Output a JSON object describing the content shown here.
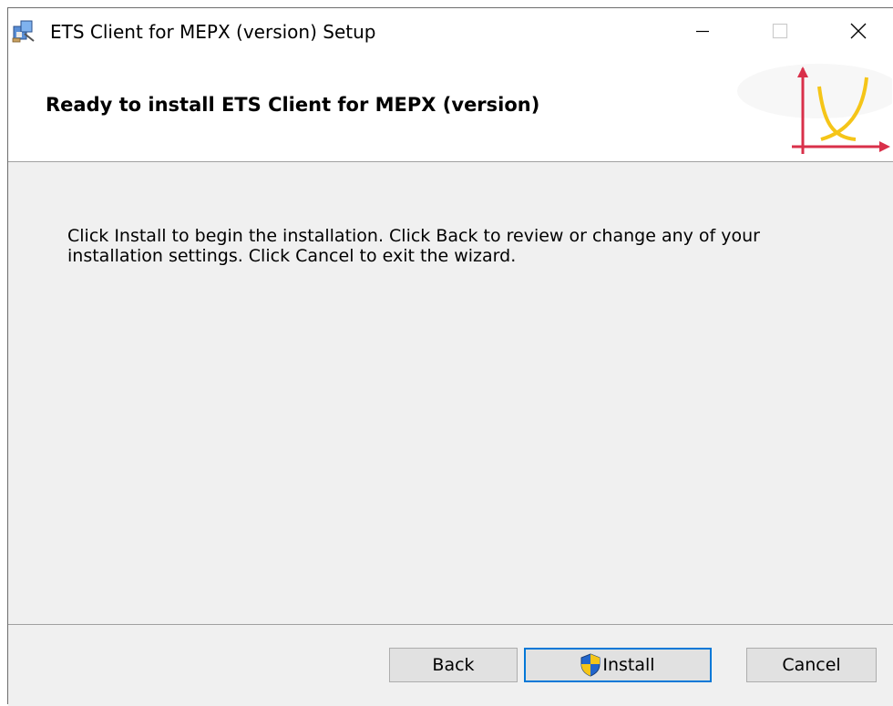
{
  "window": {
    "title": "ETS Client for MEPX (version) Setup",
    "controls": {
      "minimize_icon": "minimize-icon",
      "maximize_icon": "maximize-icon",
      "close_icon": "close-icon"
    }
  },
  "header": {
    "title": "Ready to install ETS Client for MEPX (version)",
    "logo_icon": "chart-logo-icon"
  },
  "content": {
    "description": "Click Install to begin the installation. Click Back to review or change any of your installation settings. Click Cancel to exit the wizard."
  },
  "buttons": {
    "back_label": "Back",
    "install_label": "Install",
    "cancel_label": "Cancel",
    "install_icon": "uac-shield-icon"
  },
  "colors": {
    "focus_border": "#0078d7",
    "logo_axes": "#d9304a",
    "logo_curve": "#f5c518",
    "panel_bg": "#f0f0f0"
  }
}
